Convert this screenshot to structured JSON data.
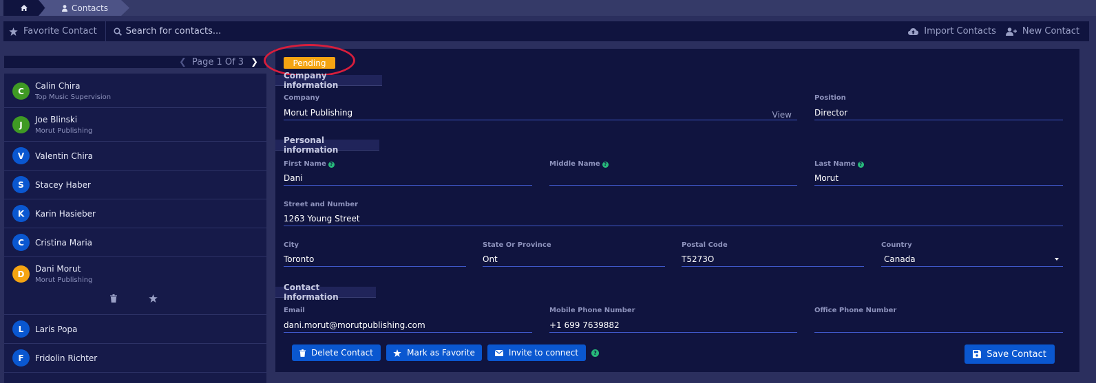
{
  "breadcrumb": {
    "home_icon": "home-icon",
    "contacts_label": "Contacts"
  },
  "toolbar": {
    "favorite_label": "Favorite Contact",
    "search_placeholder": "Search for contacts...",
    "import_label": "Import Contacts",
    "new_label": "New Contact"
  },
  "pager": {
    "text": "Page 1 Of 3"
  },
  "contacts": [
    {
      "initial": "C",
      "name": "Calin Chira",
      "company": "Top Music Supervision",
      "color": "#3f9a24"
    },
    {
      "initial": "J",
      "name": "Joe Blinski",
      "company": "Morut Publishing",
      "color": "#3f9a24"
    },
    {
      "initial": "V",
      "name": "Valentin Chira",
      "company": "",
      "color": "#0a57d0"
    },
    {
      "initial": "S",
      "name": "Stacey Haber",
      "company": "",
      "color": "#0a57d0"
    },
    {
      "initial": "K",
      "name": "Karin Hasieber",
      "company": "",
      "color": "#0a57d0"
    },
    {
      "initial": "C",
      "name": "Cristina Maria",
      "company": "",
      "color": "#0a57d0"
    },
    {
      "initial": "D",
      "name": "Dani Morut",
      "company": "Morut Publishing",
      "color": "#f5a412"
    },
    {
      "initial": "L",
      "name": "Laris Popa",
      "company": "",
      "color": "#0a57d0"
    },
    {
      "initial": "F",
      "name": "Fridolin Richter",
      "company": "",
      "color": "#0a57d0"
    }
  ],
  "detail": {
    "status": "Pending",
    "company_section": "Company information",
    "company_label": "Company",
    "company_value": "Morut Publishing",
    "view_label": "View",
    "position_label": "Position",
    "position_value": "Director",
    "personal_section": "Personal information",
    "first_name_label": "First Name",
    "first_name_value": "Dani",
    "middle_name_label": "Middle Name",
    "middle_name_value": "",
    "last_name_label": "Last Name",
    "last_name_value": "Morut",
    "street_label": "Street and Number",
    "street_value": "1263 Young Street",
    "city_label": "City",
    "city_value": "Toronto",
    "state_label": "State Or Province",
    "state_value": "Ont",
    "postal_label": "Postal Code",
    "postal_value": "T5273O",
    "country_label": "Country",
    "country_value": "Canada",
    "contact_section": "Contact Information",
    "email_label": "Email",
    "email_value": "dani.morut@morutpublishing.com",
    "mobile_label": "Mobile Phone Number",
    "mobile_value": "+1  699 7639882",
    "office_label": "Office Phone Number",
    "office_value": ""
  },
  "actions": {
    "delete_label": "Delete Contact",
    "favorite_label": "Mark as Favorite",
    "invite_label": "Invite to connect",
    "save_label": "Save Contact"
  },
  "colors": {
    "accent": "#0a57d0",
    "pending": "#f5a412",
    "highlight_ring": "#d71e3c",
    "help": "#27b87a"
  }
}
